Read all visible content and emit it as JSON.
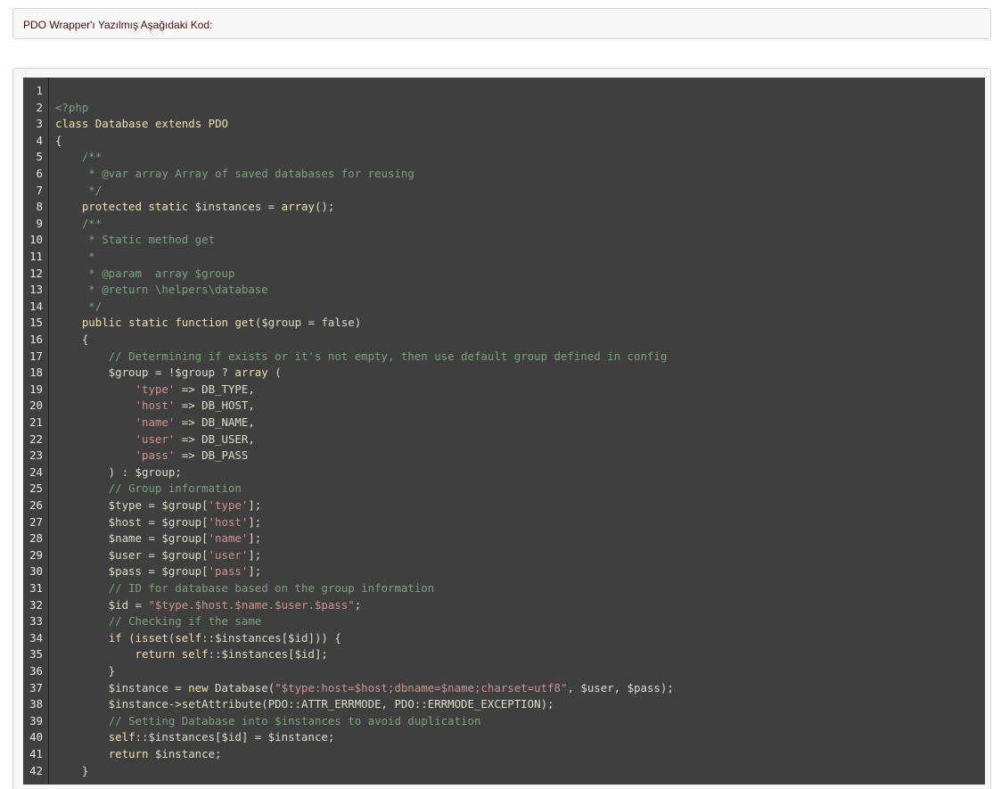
{
  "post": {
    "title": "PDO Wrapper'ı Yazılmış Aşağıdaki Kod:"
  },
  "code": {
    "language": "php",
    "colors": {
      "background": "#3f3f3f",
      "text": "#dcdccc",
      "keyword": "#f0dfaf",
      "comment": "#7f9f7f",
      "string": "#cc9393"
    },
    "lines": [
      {
        "n": "1",
        "tokens": []
      },
      {
        "n": "2",
        "tokens": [
          [
            "cm",
            "<?php"
          ]
        ]
      },
      {
        "n": "3",
        "tokens": [
          [
            "kw",
            "class"
          ],
          [
            "tx",
            " "
          ],
          [
            "kw",
            "Database"
          ],
          [
            "tx",
            " "
          ],
          [
            "kw",
            "extends"
          ],
          [
            "tx",
            " "
          ],
          [
            "kw",
            "PDO"
          ]
        ]
      },
      {
        "n": "4",
        "tokens": [
          [
            "tx",
            "{"
          ]
        ]
      },
      {
        "n": "5",
        "tokens": [
          [
            "tx",
            "    "
          ],
          [
            "cm",
            "/**"
          ]
        ]
      },
      {
        "n": "6",
        "tokens": [
          [
            "tx",
            "    "
          ],
          [
            "cm",
            " * @var array Array of saved databases for reusing"
          ]
        ]
      },
      {
        "n": "7",
        "tokens": [
          [
            "tx",
            "    "
          ],
          [
            "cm",
            " */"
          ]
        ]
      },
      {
        "n": "8",
        "tokens": [
          [
            "tx",
            "    "
          ],
          [
            "kw",
            "protected"
          ],
          [
            "tx",
            " "
          ],
          [
            "kw",
            "static"
          ],
          [
            "tx",
            " $instances = "
          ],
          [
            "kw",
            "array"
          ],
          [
            "tx",
            "();"
          ]
        ]
      },
      {
        "n": "9",
        "tokens": [
          [
            "tx",
            "    "
          ],
          [
            "cm",
            "/**"
          ]
        ]
      },
      {
        "n": "10",
        "tokens": [
          [
            "tx",
            "    "
          ],
          [
            "cm",
            " * Static method get"
          ]
        ]
      },
      {
        "n": "11",
        "tokens": [
          [
            "tx",
            "    "
          ],
          [
            "cm",
            " *"
          ]
        ]
      },
      {
        "n": "12",
        "tokens": [
          [
            "tx",
            "    "
          ],
          [
            "cm",
            " * @param  array $group"
          ]
        ]
      },
      {
        "n": "13",
        "tokens": [
          [
            "tx",
            "    "
          ],
          [
            "cm",
            " * @return \\helpers\\database"
          ]
        ]
      },
      {
        "n": "14",
        "tokens": [
          [
            "tx",
            "    "
          ],
          [
            "cm",
            " */"
          ]
        ]
      },
      {
        "n": "15",
        "tokens": [
          [
            "tx",
            "    "
          ],
          [
            "kw",
            "public"
          ],
          [
            "tx",
            " "
          ],
          [
            "kw",
            "static"
          ],
          [
            "tx",
            " "
          ],
          [
            "kw",
            "function"
          ],
          [
            "tx",
            " "
          ],
          [
            "kw",
            "get"
          ],
          [
            "tx",
            "($group = false)"
          ]
        ]
      },
      {
        "n": "16",
        "tokens": [
          [
            "tx",
            "    {"
          ]
        ]
      },
      {
        "n": "17",
        "tokens": [
          [
            "tx",
            "        "
          ],
          [
            "cm",
            "// Determining if exists or it's not empty, then use default group defined in config"
          ]
        ]
      },
      {
        "n": "18",
        "tokens": [
          [
            "tx",
            "        $group = !$group ? "
          ],
          [
            "kw",
            "array"
          ],
          [
            "tx",
            " ("
          ]
        ]
      },
      {
        "n": "19",
        "tokens": [
          [
            "tx",
            "            "
          ],
          [
            "str",
            "'type'"
          ],
          [
            "tx",
            " => DB_TYPE,"
          ]
        ]
      },
      {
        "n": "20",
        "tokens": [
          [
            "tx",
            "            "
          ],
          [
            "str",
            "'host'"
          ],
          [
            "tx",
            " => DB_HOST,"
          ]
        ]
      },
      {
        "n": "21",
        "tokens": [
          [
            "tx",
            "            "
          ],
          [
            "str",
            "'name'"
          ],
          [
            "tx",
            " => DB_NAME,"
          ]
        ]
      },
      {
        "n": "22",
        "tokens": [
          [
            "tx",
            "            "
          ],
          [
            "str",
            "'user'"
          ],
          [
            "tx",
            " => DB_USER,"
          ]
        ]
      },
      {
        "n": "23",
        "tokens": [
          [
            "tx",
            "            "
          ],
          [
            "str",
            "'pass'"
          ],
          [
            "tx",
            " => DB_PASS"
          ]
        ]
      },
      {
        "n": "24",
        "tokens": [
          [
            "tx",
            "        ) : $group;"
          ]
        ]
      },
      {
        "n": "25",
        "tokens": [
          [
            "tx",
            "        "
          ],
          [
            "cm",
            "// Group information"
          ]
        ]
      },
      {
        "n": "26",
        "tokens": [
          [
            "tx",
            "        $type = $group["
          ],
          [
            "str",
            "'type'"
          ],
          [
            "tx",
            "];"
          ]
        ]
      },
      {
        "n": "27",
        "tokens": [
          [
            "tx",
            "        $host = $group["
          ],
          [
            "str",
            "'host'"
          ],
          [
            "tx",
            "];"
          ]
        ]
      },
      {
        "n": "28",
        "tokens": [
          [
            "tx",
            "        $name = $group["
          ],
          [
            "str",
            "'name'"
          ],
          [
            "tx",
            "];"
          ]
        ]
      },
      {
        "n": "29",
        "tokens": [
          [
            "tx",
            "        $user = $group["
          ],
          [
            "str",
            "'user'"
          ],
          [
            "tx",
            "];"
          ]
        ]
      },
      {
        "n": "30",
        "tokens": [
          [
            "tx",
            "        $pass = $group["
          ],
          [
            "str",
            "'pass'"
          ],
          [
            "tx",
            "];"
          ]
        ]
      },
      {
        "n": "31",
        "tokens": [
          [
            "tx",
            "        "
          ],
          [
            "cm",
            "// ID for database based on the group information"
          ]
        ]
      },
      {
        "n": "32",
        "tokens": [
          [
            "tx",
            "        $id = "
          ],
          [
            "str",
            "\"$type.$host.$name.$user.$pass\""
          ],
          [
            "tx",
            ";"
          ]
        ]
      },
      {
        "n": "33",
        "tokens": [
          [
            "tx",
            "        "
          ],
          [
            "cm",
            "// Checking if the same"
          ]
        ]
      },
      {
        "n": "34",
        "tokens": [
          [
            "tx",
            "        "
          ],
          [
            "kw",
            "if"
          ],
          [
            "tx",
            " ("
          ],
          [
            "kw",
            "isset"
          ],
          [
            "tx",
            "("
          ],
          [
            "kw",
            "self"
          ],
          [
            "tx",
            "::$instances[$id])) {"
          ]
        ]
      },
      {
        "n": "35",
        "tokens": [
          [
            "tx",
            "            "
          ],
          [
            "kw",
            "return"
          ],
          [
            "tx",
            " "
          ],
          [
            "kw",
            "self"
          ],
          [
            "tx",
            "::$instances[$id];"
          ]
        ]
      },
      {
        "n": "36",
        "tokens": [
          [
            "tx",
            "        }"
          ]
        ]
      },
      {
        "n": "37",
        "tokens": [
          [
            "tx",
            "        $instance = "
          ],
          [
            "kw",
            "new"
          ],
          [
            "tx",
            " Database("
          ],
          [
            "str",
            "\"$type:host=$host;dbname=$name;charset=utf8\""
          ],
          [
            "tx",
            ", $user, $pass);"
          ]
        ]
      },
      {
        "n": "38",
        "tokens": [
          [
            "tx",
            "        $instance->setAttribute(PDO::ATTR_ERRMODE, PDO::ERRMODE_EXCEPTION);"
          ]
        ]
      },
      {
        "n": "39",
        "tokens": [
          [
            "tx",
            "        "
          ],
          [
            "cm",
            "// Setting Database into $instances to avoid duplication"
          ]
        ]
      },
      {
        "n": "40",
        "tokens": [
          [
            "tx",
            "        "
          ],
          [
            "kw",
            "self"
          ],
          [
            "tx",
            "::$instances[$id] = $instance;"
          ]
        ]
      },
      {
        "n": "41",
        "tokens": [
          [
            "tx",
            "        "
          ],
          [
            "kw",
            "return"
          ],
          [
            "tx",
            " $instance;"
          ]
        ]
      },
      {
        "n": "42",
        "tokens": [
          [
            "tx",
            "    }"
          ]
        ]
      }
    ]
  }
}
